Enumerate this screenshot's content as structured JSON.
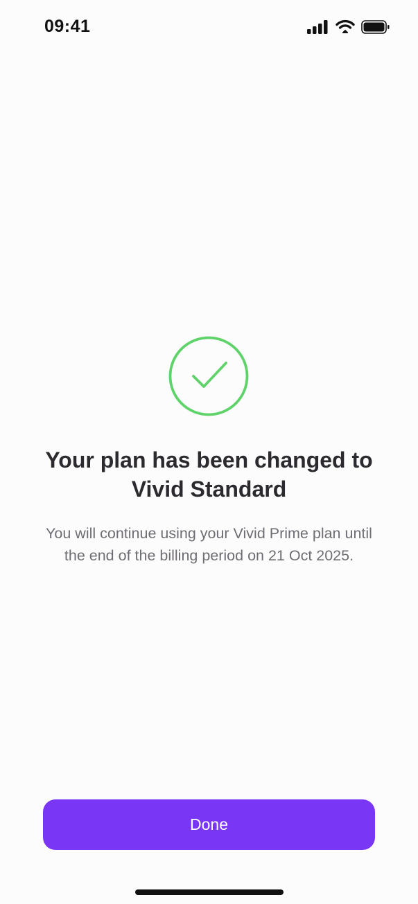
{
  "status_bar": {
    "time": "09:41",
    "icons": [
      "cellular-signal-icon",
      "wifi-icon",
      "battery-icon"
    ]
  },
  "confirmation": {
    "icon": "checkmark-circle-icon",
    "icon_color": "#5fd36a",
    "title_line1": "Your plan has been changed to",
    "title_line2": "Vivid Standard",
    "message_line1": "You will continue using your Vivid Prime plan until",
    "message_line2": "the end of the billing period on 21 Oct 2025."
  },
  "actions": {
    "done_label": "Done",
    "accent_color": "#7a36f5"
  }
}
